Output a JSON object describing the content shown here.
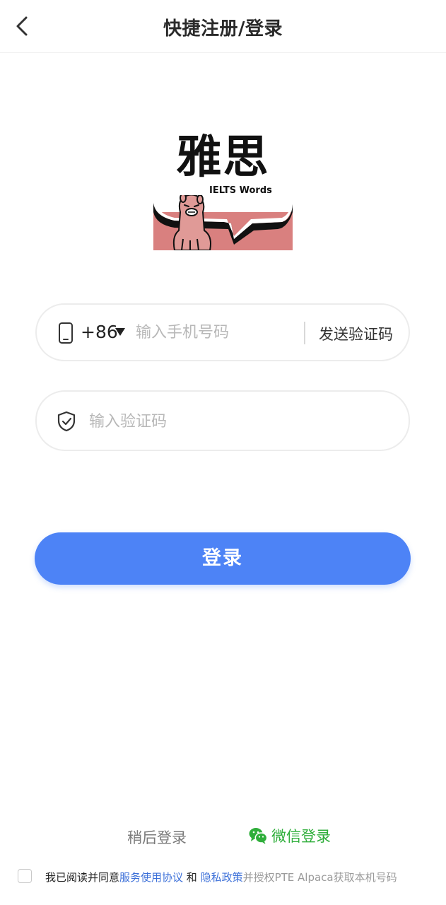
{
  "header": {
    "title": "快捷注册/登录",
    "back_icon": "chevron-left-icon"
  },
  "logo": {
    "title": "雅思",
    "subtitle": "IELTS Words",
    "colors": {
      "pink": "#d9807f",
      "black": "#111111"
    }
  },
  "phone_field": {
    "icon": "smartphone-icon",
    "country_code": "+86",
    "caret_icon": "caret-down-icon",
    "placeholder": "输入手机号码",
    "value": "",
    "send_code_label": "发送验证码"
  },
  "code_field": {
    "icon": "shield-check-icon",
    "placeholder": "输入验证码",
    "value": ""
  },
  "login_button": {
    "label": "登录",
    "color": "#4d83f6"
  },
  "alt_login": {
    "later_label": "稍后登录",
    "wechat_label": "微信登录",
    "wechat_icon": "wechat-icon",
    "wechat_color": "#2fae3b"
  },
  "agreement": {
    "checked": false,
    "prefix": "我已阅读并同意",
    "terms_link": "服务使用协议",
    "and": " 和 ",
    "privacy_link": "隐私政策",
    "suffix": "并授权PTE Alpaca获取本机号码"
  }
}
